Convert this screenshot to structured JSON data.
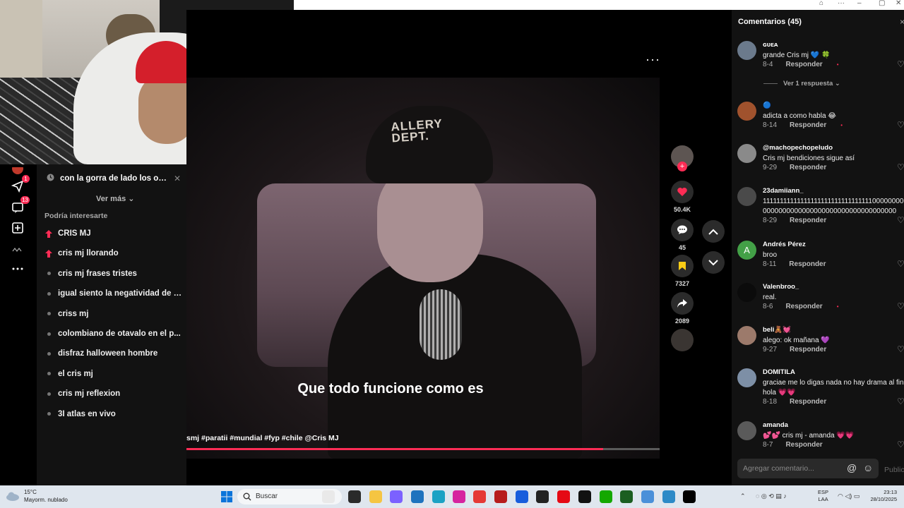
{
  "window": {
    "controls": [
      "⌂",
      "···",
      "–",
      "▢",
      "✕"
    ]
  },
  "sidebar": {
    "messages_badge": "1",
    "inbox_badge": "13"
  },
  "search_panel": {
    "recent": "con la gorra de lado los ojos...",
    "ver_mas": "Ver más",
    "section_title": "Podría interesarte",
    "suggestions": [
      {
        "text": "CRIS MJ",
        "trending": true
      },
      {
        "text": "cris mj llorando",
        "trending": true
      },
      {
        "text": "cris mj frases tristes",
        "trending": false
      },
      {
        "text": "igual siento la negatividad de l...",
        "trending": false
      },
      {
        "text": "criss mj",
        "trending": false
      },
      {
        "text": "colombiano de otavalo en el p...",
        "trending": false
      },
      {
        "text": "disfraz halloween hombre",
        "trending": false
      },
      {
        "text": "el cris mj",
        "trending": false
      },
      {
        "text": "cris mj reflexion",
        "trending": false
      },
      {
        "text": "3I atlas en vivo",
        "trending": false
      }
    ]
  },
  "video": {
    "hat_text": "ALLERY\nDEPT.",
    "subtitle": "Que todo funcione como es",
    "tags": "smj  #paratii  #mundial  #fyp  #chile  @Cris MJ",
    "progress": 0.88,
    "more_icon": "···"
  },
  "actions": {
    "likes": "50.4K",
    "comments": "45",
    "saves": "7327",
    "shares": "2089"
  },
  "comments": {
    "header": "Comentarios (45)",
    "close": "×",
    "reply_label": "Responder",
    "view_replies": "Ver 1 respuesta ⌄",
    "placeholder": "Agregar comentario...",
    "publish": "Publicar",
    "items": [
      {
        "user": "ɢᴜᴇᴀ",
        "text": "grande Cris mj 💙 🍀",
        "date": "8-4",
        "avatar": "#6b7a8c",
        "liked_by_author": true
      },
      {
        "user": "🔵",
        "text": "adicta a como habla 😂",
        "date": "8-14",
        "avatar": "#a0522d",
        "liked_by_author": true
      },
      {
        "user": "@machopechopeludo",
        "text": "Cris mj bendiciones sigue así",
        "date": "9-29",
        "avatar": "#8a8a8a",
        "liked_by_author": false
      },
      {
        "user": "23damiiann_",
        "text": "111111111111111111111111111111110000000000000\n0000000000000000000000000000000000",
        "date": "8-29",
        "avatar": "#4a4a4a",
        "liked_by_author": false
      },
      {
        "user": "Andrés Pérez",
        "text": "broo",
        "date": "8-11",
        "avatar": "#43a047",
        "initial": "A",
        "liked_by_author": false
      },
      {
        "user": "Valenbroo_",
        "text": "real.",
        "date": "8-6",
        "avatar": "#0b0b0b",
        "liked_by_author": true
      },
      {
        "user": "beli🧸💓",
        "text": "alego: ok mañana 💜",
        "date": "9-27",
        "avatar": "#9c7a6b",
        "liked_by_author": false
      },
      {
        "user": "DOMITILA",
        "text": "graciae me lo digas nada no hay drama al final\nhola 💗💗",
        "date": "8-18",
        "avatar": "#7d8fa6",
        "liked_by_author": false
      },
      {
        "user": "amanda",
        "text": "💕💕 cris mj - amanda 💗💗",
        "date": "8-7",
        "avatar": "#5a5a5a",
        "liked_by_author": false
      }
    ]
  },
  "taskbar": {
    "temp": "15°C",
    "weather": "Mayorm. nublado",
    "search": "Buscar",
    "lang1": "ESP",
    "lang2": "LAA",
    "time": "23:13",
    "date": "28/10/2025"
  },
  "colors": {
    "accent": "#fe2c55",
    "bookmark": "#facc15",
    "panel": "#121212"
  }
}
